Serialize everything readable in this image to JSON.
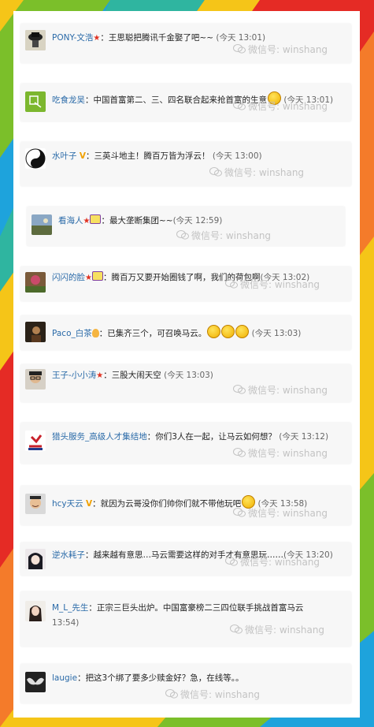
{
  "colors": {
    "stripe_red": "#e52b25",
    "stripe_orange": "#f47b2a",
    "stripe_yellow": "#f5c518",
    "stripe_green": "#7bbf2a",
    "stripe_blue": "#1ea3dc",
    "link_blue": "#2a6aa8",
    "card_bg": "#f7f7f7"
  },
  "watermark": "微信号: winshang",
  "comments": [
    {
      "user": "PONY-文浩",
      "badges": [
        "star-icon"
      ],
      "text": "王思聪把腾讯千金娶了吧~~",
      "time": "(今天 13:01)",
      "avatar": "hat-person-avatar"
    },
    {
      "user": "吃食龙吴",
      "badges": [],
      "text": "中国首富第二、三、四名联合起来抢首富的生意",
      "time": "(今天 13:01)",
      "emoji": [
        "grin-emoji"
      ],
      "avatar": "green-logo-avatar"
    },
    {
      "user": "水叶子",
      "badges": [
        "v-badge"
      ],
      "text": "三英斗地主！腾百万皆为浮云！",
      "time": "(今天 13:00)",
      "avatar": "yin-yang-avatar"
    },
    {
      "user": "看海人",
      "badges": [
        "star-icon",
        "tv-icon"
      ],
      "text": "最大垄断集团~~",
      "time": "(今天 12:59)",
      "avatar": "landscape-avatar"
    },
    {
      "user": "闪闪的脸",
      "badges": [
        "star-icon",
        "tv-icon"
      ],
      "text": "腾百万又要开始圈钱了啊，我们的荷包啊",
      "time": "(今天 13:02)",
      "avatar": "flower-avatar"
    },
    {
      "user": "Paco_白茶",
      "badges": [
        "bulb-icon"
      ],
      "text": "已集齐三个，可召唤马云。",
      "time": "(今天 13:03)",
      "emoji": [
        "grin-emoji",
        "grin-emoji",
        "grin-emoji"
      ],
      "avatar": "dark-portrait-avatar"
    },
    {
      "user": "王子-小小涛",
      "badges": [
        "star-icon"
      ],
      "text": "三股大闹天空",
      "time": "(今天 13:03)",
      "avatar": "glasses-person-avatar"
    },
    {
      "user": "猎头服务_高级人才集结地",
      "badges": [],
      "text": "你们3人在一起，让马云如何想？",
      "time": "(今天 13:12)",
      "avatar": "red-logo-avatar"
    },
    {
      "user": "hcy天云",
      "badges": [
        "v-badge"
      ],
      "text": "就因为云哥没你们帅你们就不带他玩吧",
      "time": "(今天 13:58)",
      "emoji": [
        "wink-emoji"
      ],
      "avatar": "smiling-man-avatar"
    },
    {
      "user": "逆水耗子",
      "badges": [],
      "text": "越来越有意思…马云需要这样的对手才有意思玩……",
      "time": "(今天 13:20)",
      "avatar": "anime-girl-avatar"
    },
    {
      "user": "M_L_先生",
      "badges": [],
      "text": "正宗三巨头出炉。中国富豪榜二三四位联手挑战首富马云",
      "time": "13:54)",
      "avatar": "woman-portrait-avatar"
    },
    {
      "user": "laugie",
      "badges": [],
      "text": "把这3个绑了要多少赎金好？急，在线等。。",
      "time": "",
      "avatar": "wings-avatar"
    }
  ]
}
